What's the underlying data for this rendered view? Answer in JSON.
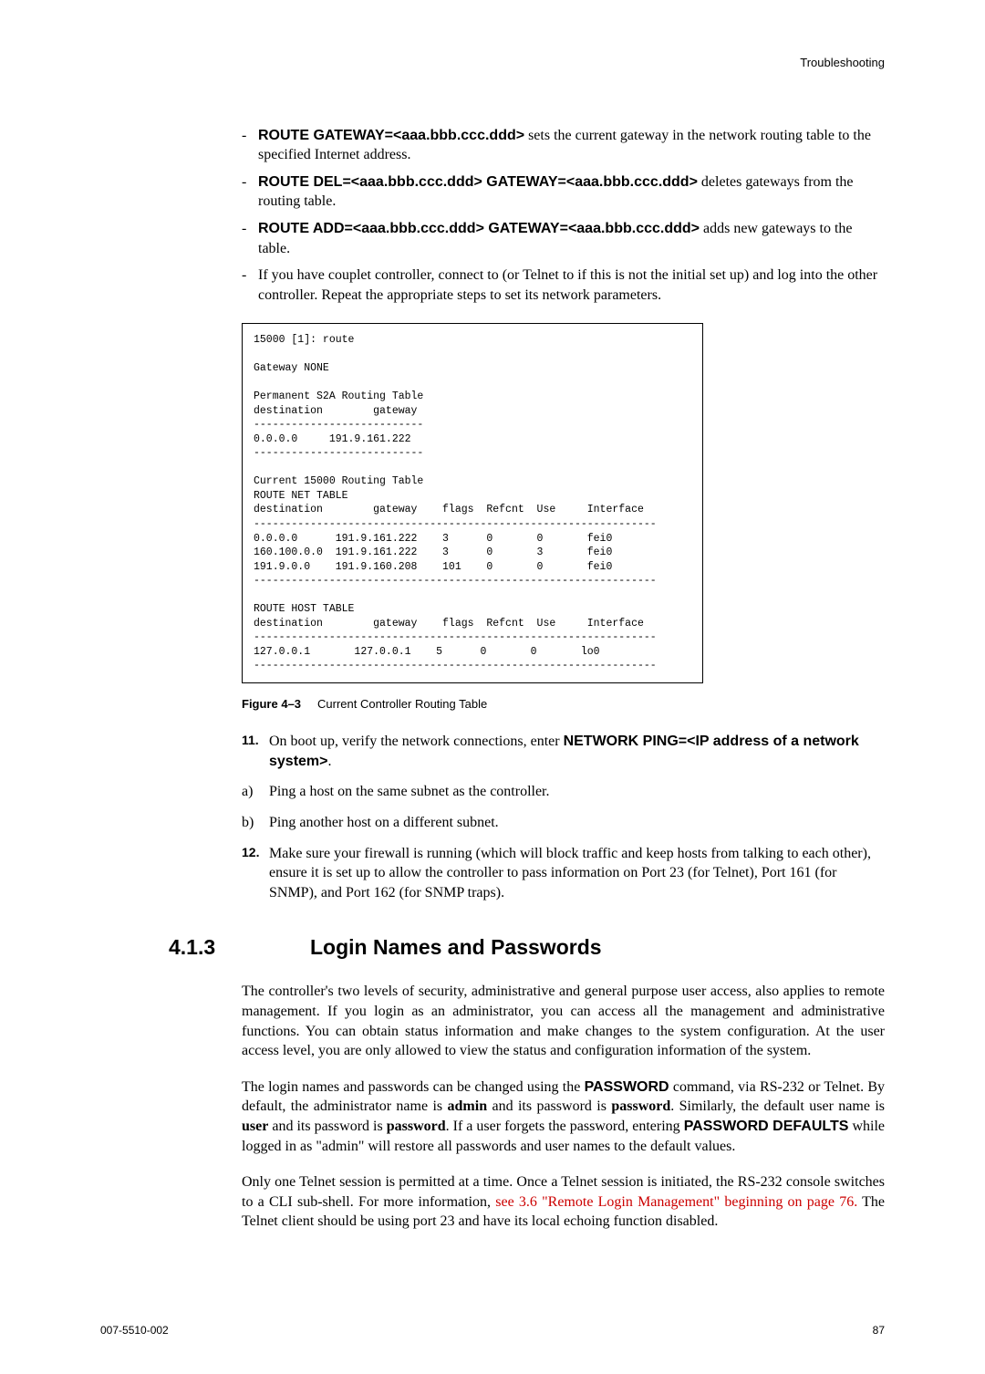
{
  "header": {
    "right": "Troubleshooting"
  },
  "bullets": [
    {
      "cmd": "ROUTE GATEWAY=<aaa.bbb.ccc.ddd>",
      "tail": " sets the current gateway in the network routing table to the specified Internet address."
    },
    {
      "cmd": "ROUTE DEL=<aaa.bbb.ccc.ddd> GATEWAY=<aaa.bbb.ccc.ddd>",
      "tail": " deletes gateways from the routing table."
    },
    {
      "cmd": "ROUTE ADD=<aaa.bbb.ccc.ddd> GATEWAY=<aaa.bbb.ccc.ddd>",
      "tail": " adds new gateways to the table."
    },
    {
      "plain": "If you have couplet controller, connect to (or Telnet to if this is not the initial set up) and log into the other controller. Repeat the appropriate steps to set its network parameters."
    }
  ],
  "code": "15000 [1]: route\n\nGateway NONE\n\nPermanent S2A Routing Table\ndestination        gateway\n---------------------------\n0.0.0.0     191.9.161.222\n---------------------------\n\nCurrent 15000 Routing Table\nROUTE NET TABLE\ndestination        gateway    flags  Refcnt  Use     Interface\n----------------------------------------------------------------\n0.0.0.0      191.9.161.222    3      0       0       fei0\n160.100.0.0  191.9.161.222    3      0       3       fei0\n191.9.0.0    191.9.160.208    101    0       0       fei0\n----------------------------------------------------------------\n\nROUTE HOST TABLE\ndestination        gateway    flags  Refcnt  Use     Interface\n----------------------------------------------------------------\n127.0.0.1       127.0.0.1    5      0       0       lo0\n----------------------------------------------------------------",
  "figure": {
    "label": "Figure 4–3",
    "caption": "Current Controller Routing Table"
  },
  "step11": {
    "marker": "11.",
    "lead": "On boot up, verify the network connections, enter ",
    "cmd": "NETWORK PING=<IP address of a network system>",
    "tail": "."
  },
  "step11a": {
    "marker": "a)",
    "text": "Ping a host on the same subnet as the controller."
  },
  "step11b": {
    "marker": "b)",
    "text": "Ping another host on a different subnet."
  },
  "step12": {
    "marker": "12.",
    "text": "Make sure your firewall is running (which will block traffic and keep hosts from talking to each other), ensure it is set up to allow the controller to pass information on Port 23 (for Telnet), Port 161 (for SNMP), and Port 162 (for SNMP traps)."
  },
  "section": {
    "number": "4.1.3",
    "title": "Login Names and Passwords"
  },
  "para1": "The controller's two levels of security, administrative and general purpose user access, also applies to remote management. If you login as an administrator, you can access all the management and administrative functions. You can obtain status information and make changes to the system configuration. At the user access level, you are only allowed to view the status and configuration information of the system.",
  "para2": {
    "p1": "The login names and passwords can be changed using the ",
    "b1": "PASSWORD",
    "p2": " command, via RS-232 or Telnet. By default, the administrator name is ",
    "b2": "admin",
    "p3": " and its password is ",
    "b3": "password",
    "p4": ". Similarly, the default user name is ",
    "b4": "user",
    "p5": " and its password is ",
    "b5": "password",
    "p6": ". If a user forgets the password, entering ",
    "b6": "PASSWORD DEFAULTS",
    "p7": " while logged in as \"admin\" will restore all passwords and user names to the default values."
  },
  "para3": {
    "p1": "Only one Telnet session is permitted at a time. Once a Telnet session is initiated, the RS-232 console switches to a CLI sub-shell. For more information, ",
    "link": "see 3.6 \"Remote Login Management\" beginning on page 76.",
    "p2": " The Telnet client should be using port 23 and have its local echoing function disabled."
  },
  "footer": {
    "left": "007-5510-002",
    "right": "87"
  }
}
